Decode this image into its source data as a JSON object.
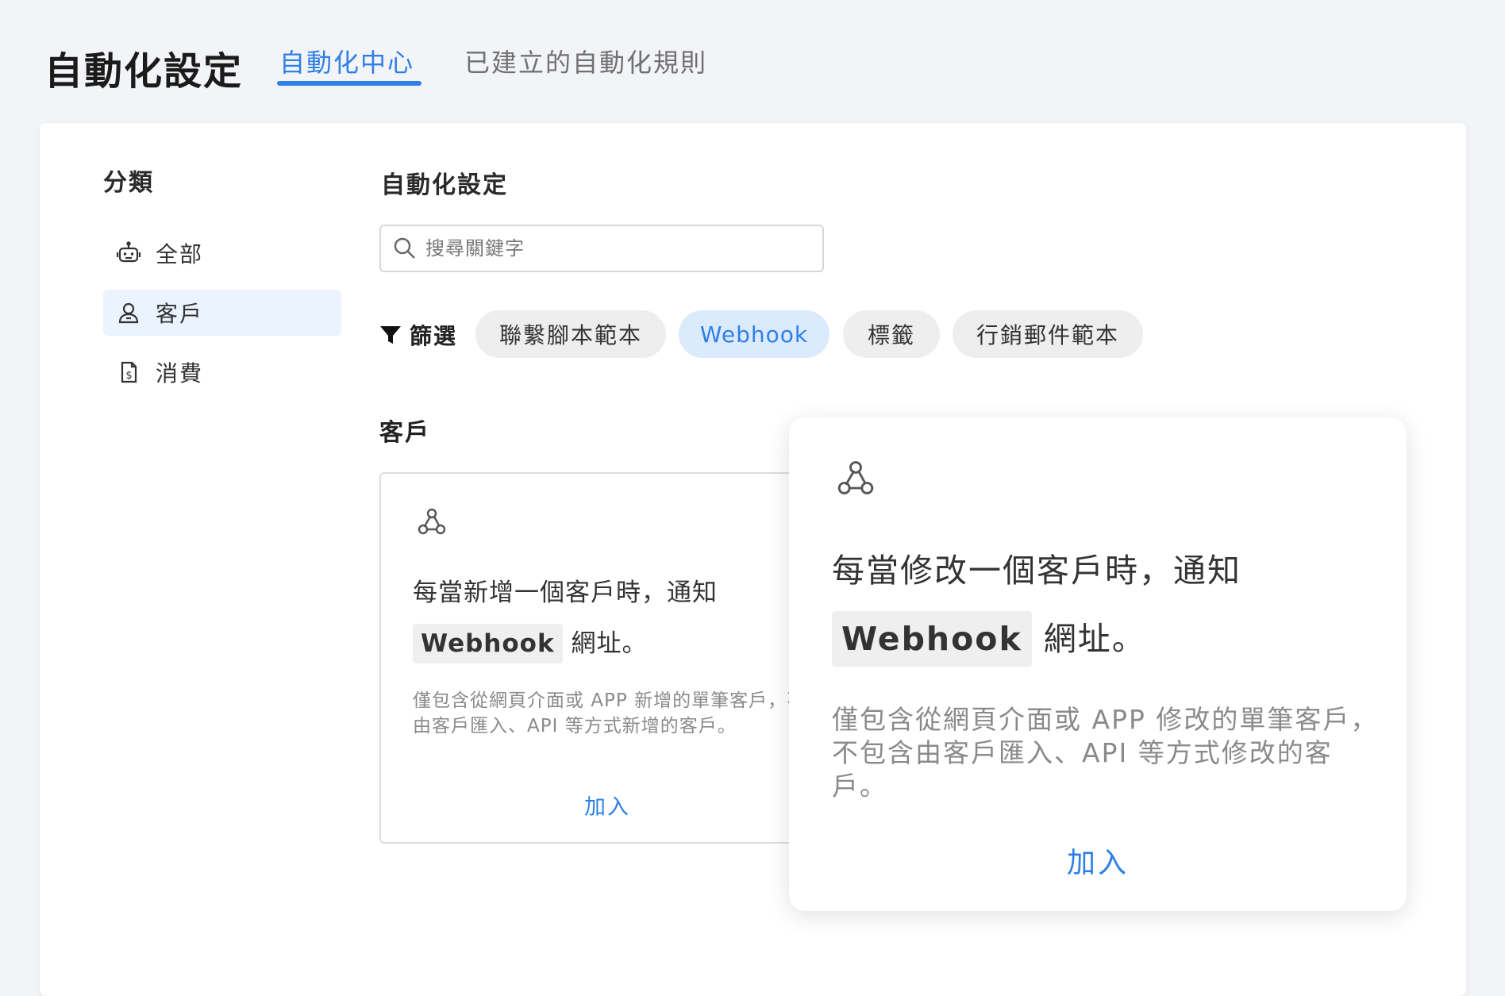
{
  "header": {
    "title": "自動化設定",
    "tabs": [
      {
        "label": "自動化中心",
        "active": true
      },
      {
        "label": "已建立的自動化規則",
        "active": false
      }
    ]
  },
  "sidebar": {
    "heading": "分類",
    "items": [
      {
        "label": "全部",
        "icon": "robot-icon",
        "active": false
      },
      {
        "label": "客戶",
        "icon": "user-icon",
        "active": true
      },
      {
        "label": "消費",
        "icon": "receipt-icon",
        "active": false
      }
    ]
  },
  "main": {
    "heading": "自動化設定",
    "search": {
      "placeholder": "搜尋關鍵字",
      "value": ""
    },
    "filter": {
      "label": "篩選",
      "chips": [
        {
          "label": "聯繫腳本範本",
          "active": false
        },
        {
          "label": "Webhook",
          "active": true
        },
        {
          "label": "標籤",
          "active": false
        },
        {
          "label": "行銷郵件範本",
          "active": false
        }
      ]
    },
    "section_heading": "客戶",
    "cards": [
      {
        "icon": "webhook-icon",
        "title_prefix": "每當新增一個客戶時，通知",
        "title_code": "Webhook",
        "title_suffix": " 網址。",
        "description": "僅包含從網頁介面或 APP 新增的單筆客戶，不包含由客戶匯入、API 等方式新增的客戶。",
        "action": "加入"
      }
    ],
    "popup": {
      "icon": "webhook-icon",
      "title_prefix": "每當修改一個客戶時，通知",
      "title_code": "Webhook",
      "title_suffix": " 網址。",
      "description": "僅包含從網頁介面或 APP 修改的單筆客戶，不包含由客戶匯入、API 等方式修改的客戶。",
      "action": "加入"
    }
  },
  "colors": {
    "accent": "#2f80e6",
    "active_bg": "#eaf3fe",
    "chip_active_bg": "#dbeafd",
    "chip_bg": "#eeeeee",
    "muted_text": "#8a8a8a"
  }
}
